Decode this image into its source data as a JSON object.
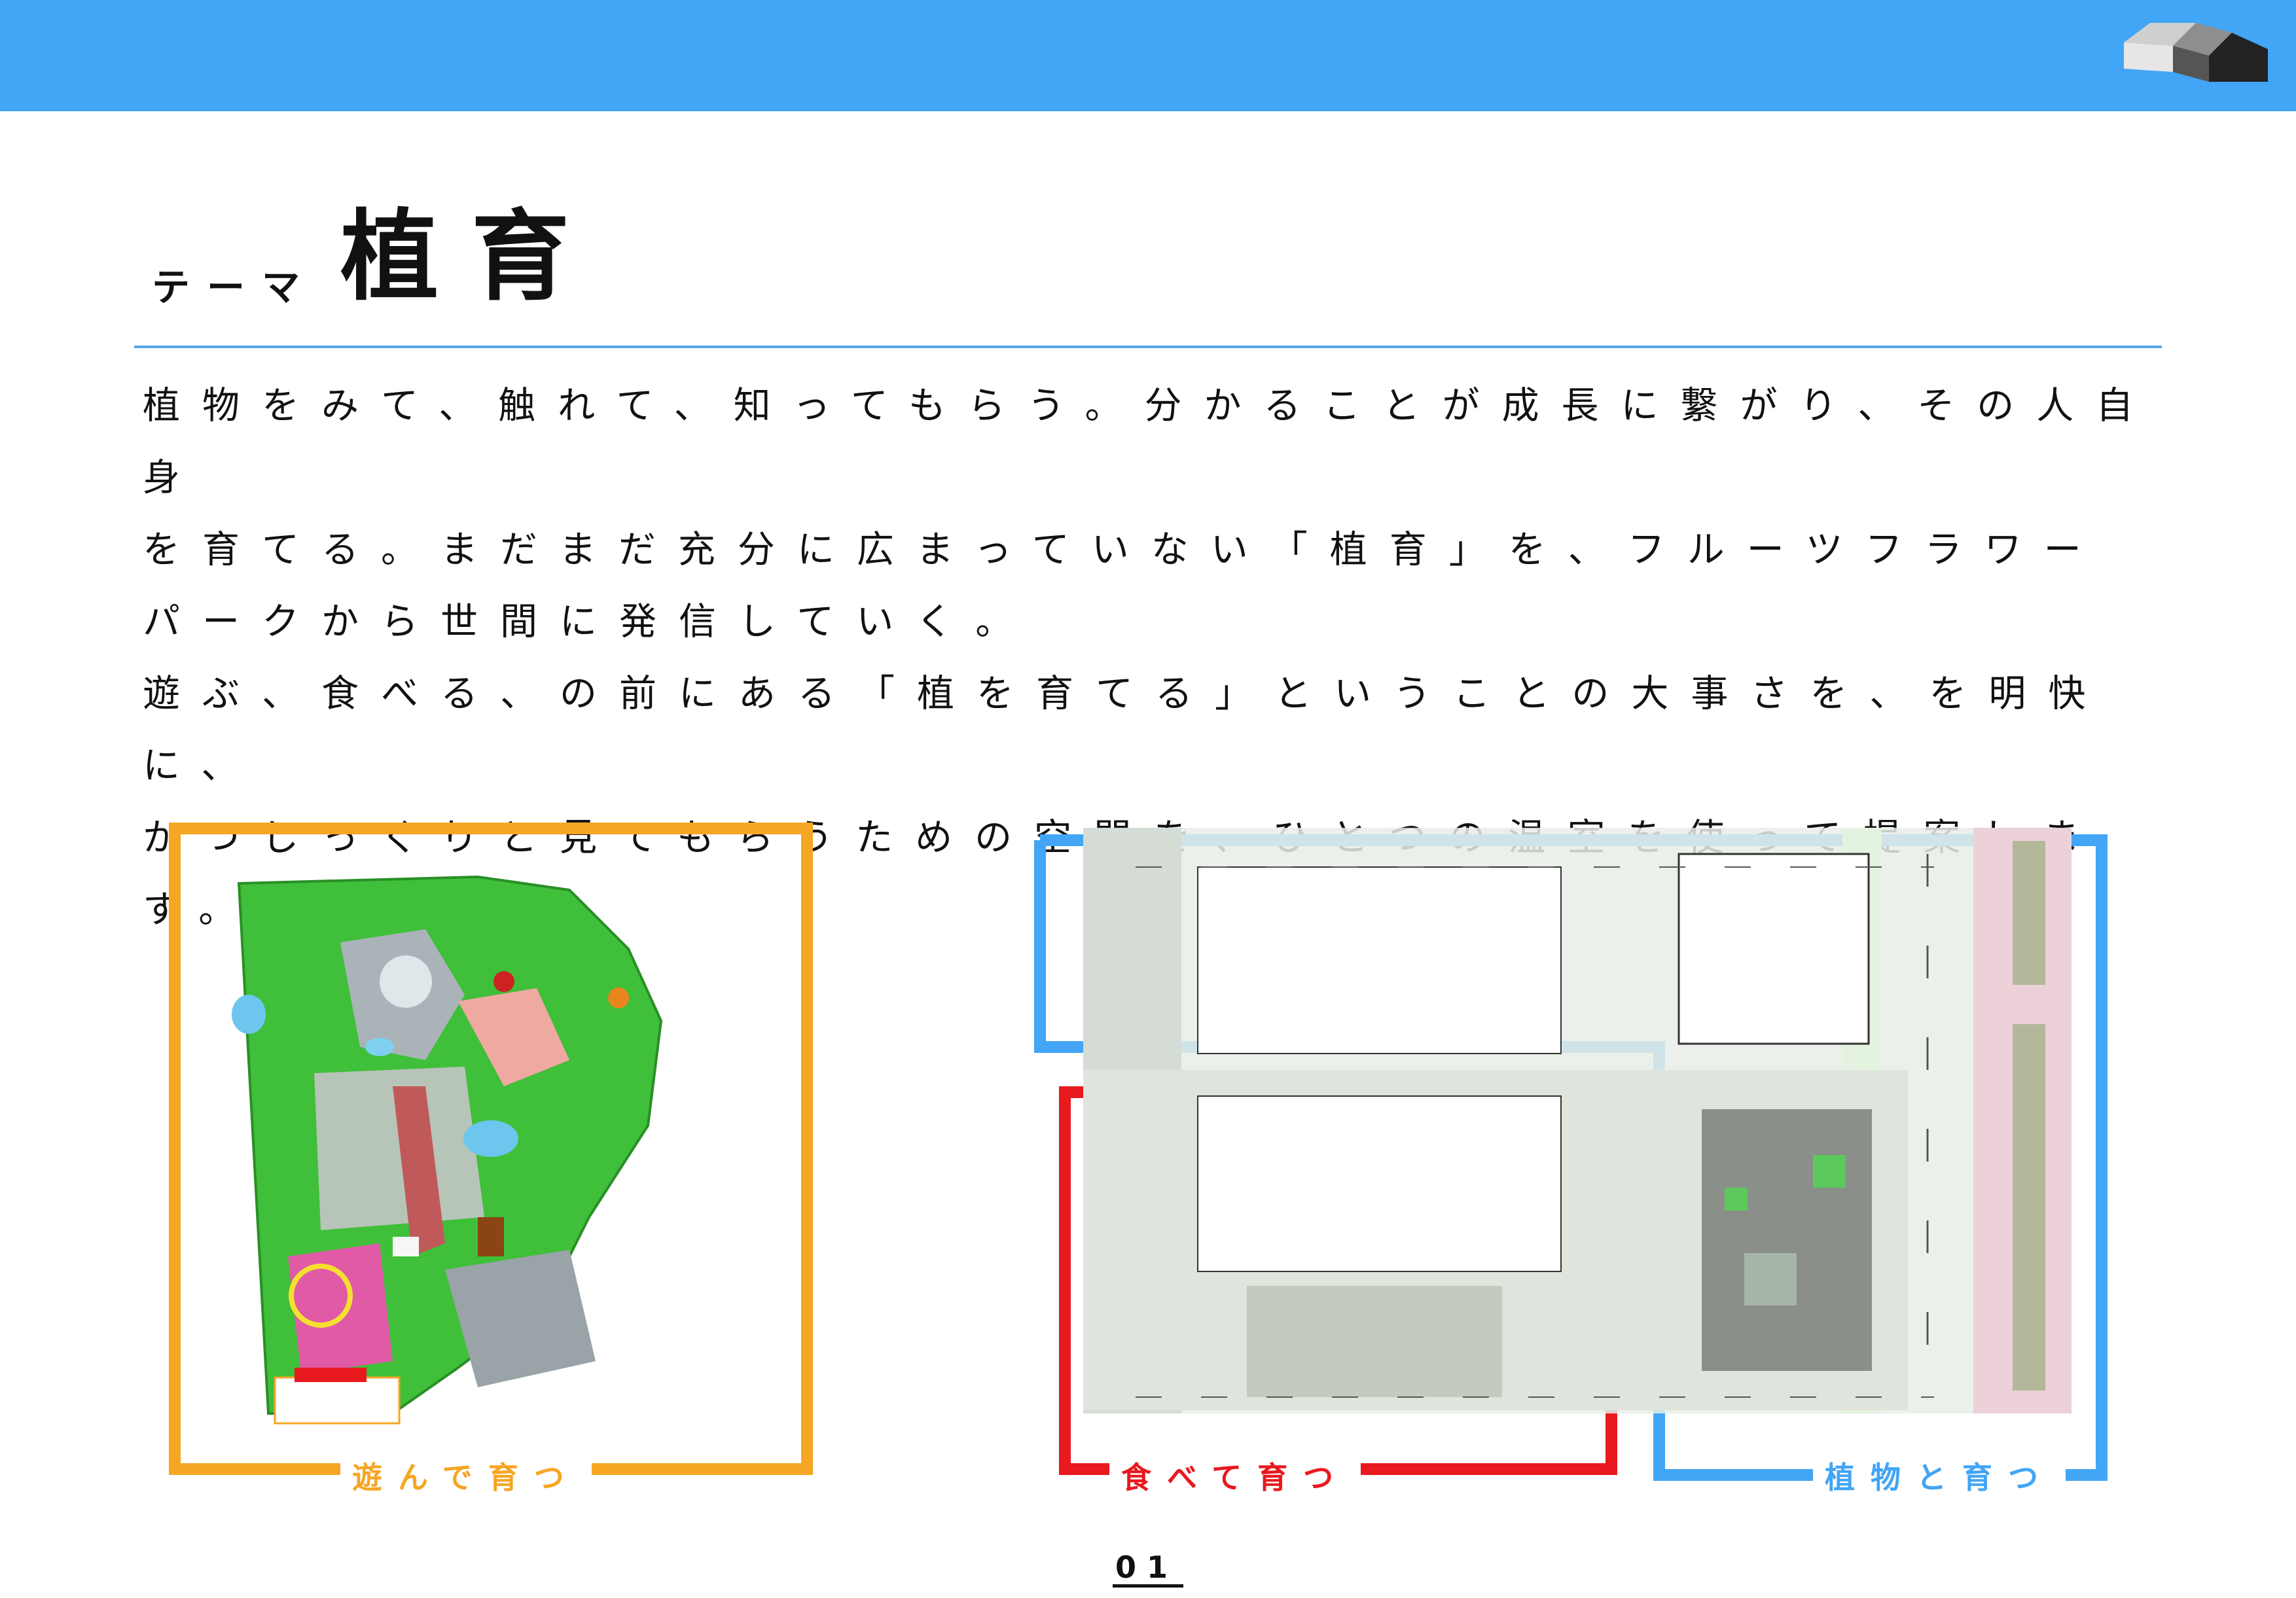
{
  "header": {
    "title_small": "テーマ",
    "title_big": "植育"
  },
  "body_lines": [
    "植物をみて、触れて、知ってもらう。分かることが成長に繋がり、その人自身",
    "を育てる。まだまだ充分に広まっていない「植育」を、フルーツフラワー",
    "パークから世間に発信していく。",
    "遊ぶ、食べる、の前にある「植を育てる」ということの大事さを、を明快に、",
    "かつじっくりと見てもらうための空間を、ひとつの温室を使って提案します。"
  ],
  "sections": {
    "play": {
      "label": "遊んで育つ",
      "color": "#f5a623"
    },
    "eat": {
      "label": "食べて育つ",
      "color": "#e8191f"
    },
    "plants": {
      "label": "植物と育つ",
      "color": "#42a5f5"
    }
  },
  "page_number": "01",
  "colors": {
    "accent_blue": "#42a5f5"
  }
}
